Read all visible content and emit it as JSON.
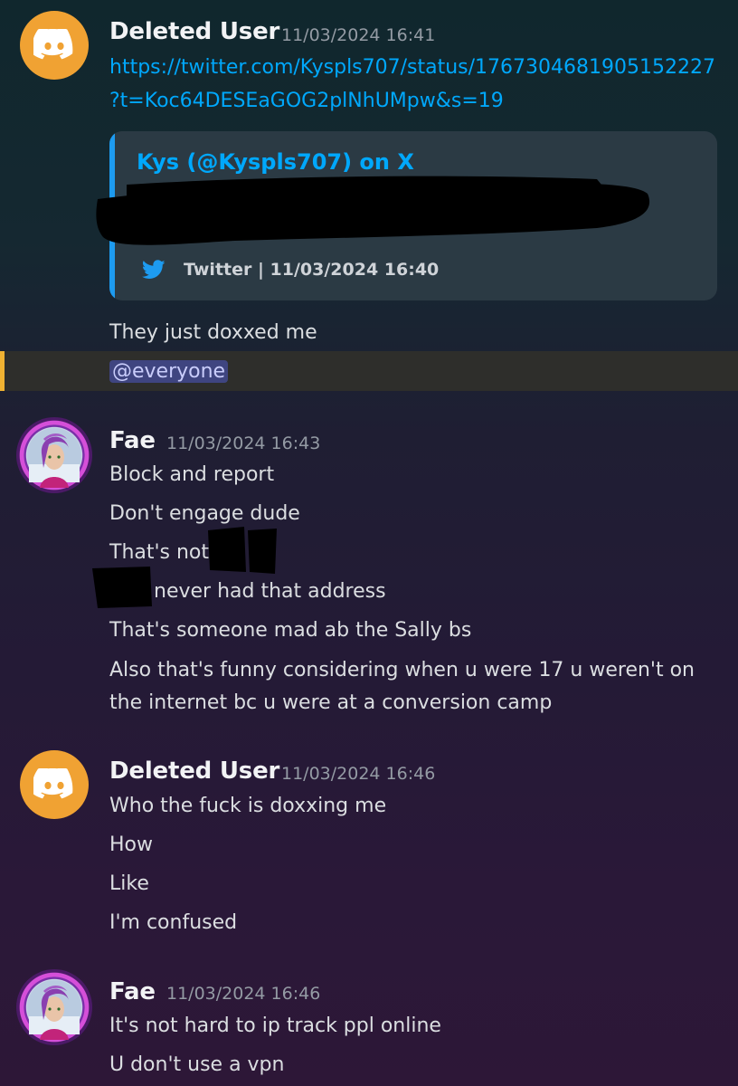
{
  "messages": [
    {
      "author": "Deleted User",
      "timestamp": "11/03/2024 16:41",
      "link_line1": "https://twitter.com/Kyspls707/status/1767304681905152227",
      "link_line2": "?t=Koc64DESEaGOG2plNhUMpw&s=19",
      "embed": {
        "title": "Kys (@Kyspls707) on X",
        "footer": "Twitter | 11/03/2024 16:40"
      },
      "lines": [
        "They just doxxed me",
        "@everyone"
      ]
    },
    {
      "author": "Fae",
      "timestamp": "11/03/2024 16:43",
      "lines": [
        "Block and report",
        "Don't engage dude",
        "That's not",
        "never had that address",
        "That's someone mad ab the Sally bs",
        "Also that's funny considering when u were 17 u weren't on",
        "the internet bc u were at a conversion camp"
      ]
    },
    {
      "author": "Deleted User",
      "timestamp": "11/03/2024 16:46",
      "lines": [
        "Who the fuck is doxxing me",
        "How",
        "Like",
        "I'm confused"
      ]
    },
    {
      "author": "Fae",
      "timestamp": "11/03/2024 16:46",
      "lines": [
        "It's not hard to ip track ppl online",
        "U don't use a vpn"
      ]
    }
  ],
  "icons": {
    "discord": "discord-logo-icon",
    "twitter": "twitter-bird-icon"
  },
  "colors": {
    "link": "#00a8fc",
    "discord_avatar": "#f0a233",
    "mention_bg": "#3f4580",
    "mention_bar": "#f0b232"
  }
}
